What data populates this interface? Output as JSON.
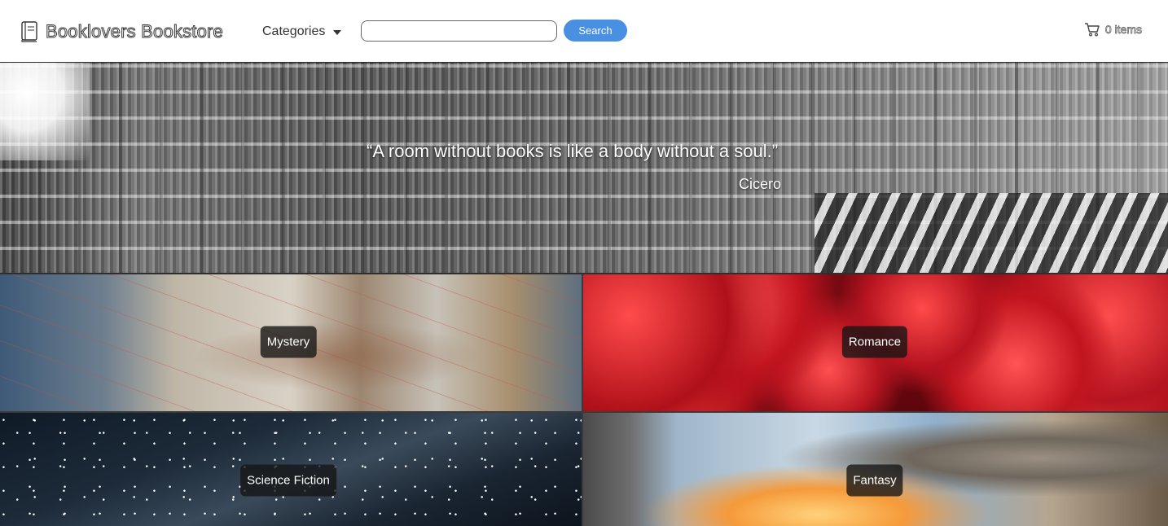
{
  "header": {
    "brand": "Booklovers Bookstore",
    "categories_label": "Categories",
    "search": {
      "value": "",
      "placeholder": ""
    },
    "search_button_label": "Search",
    "cart_label": "0 items"
  },
  "hero": {
    "quote": "“A room without books is like a body without a soul.”",
    "author": "Cicero"
  },
  "categories": [
    {
      "label": "Mystery"
    },
    {
      "label": "Romance"
    },
    {
      "label": "Science Fiction"
    },
    {
      "label": "Fantasy"
    }
  ],
  "icons": {
    "brand": "book-icon",
    "categories": "caret-down-icon",
    "cart": "cart-icon"
  },
  "colors": {
    "search_button": "#4a90e2",
    "label_background": "#141414"
  }
}
